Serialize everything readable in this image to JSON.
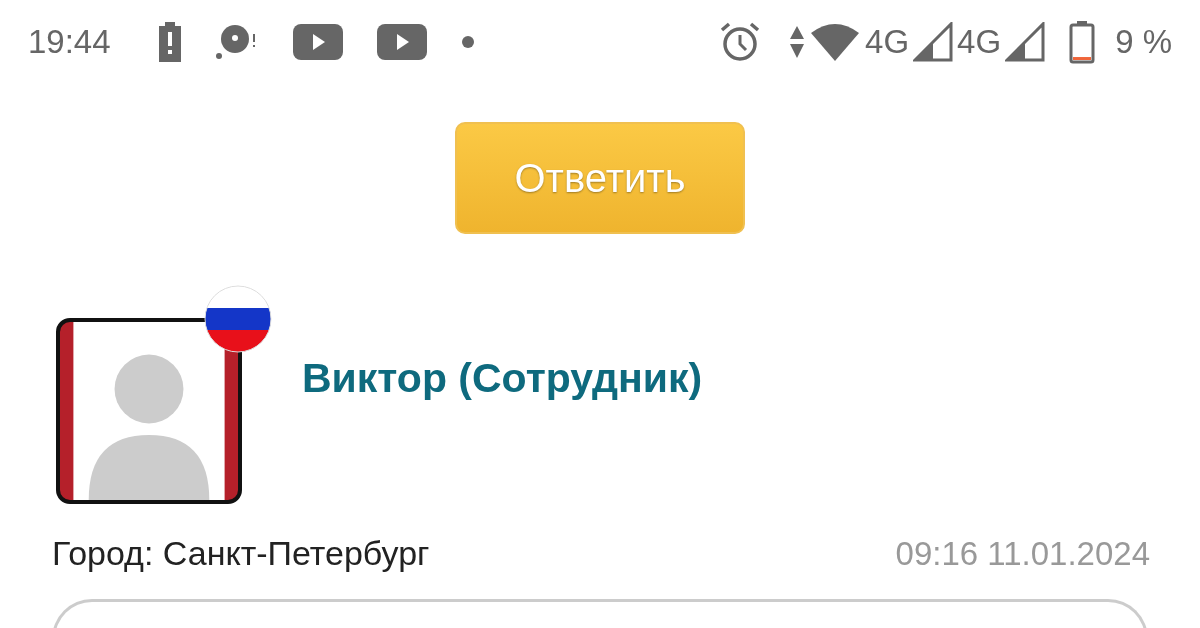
{
  "status_bar": {
    "time": "19:44",
    "network_labels": [
      "4G",
      "4G"
    ],
    "battery": {
      "level": 0.09,
      "text": "9 %"
    }
  },
  "reply_button": {
    "label": "Ответить"
  },
  "author": {
    "name": "Виктор (Сотрудник)",
    "city": "Город: Санкт-Петербург",
    "datetime": "09:16 11.01.2024"
  }
}
